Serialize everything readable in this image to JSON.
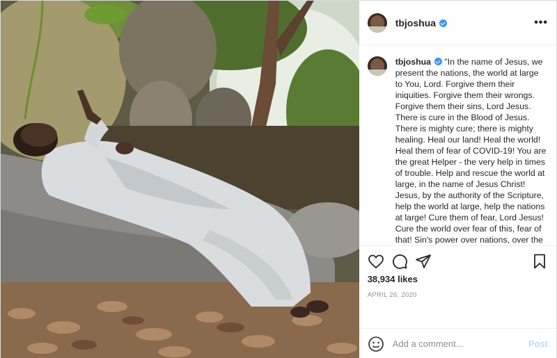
{
  "post": {
    "username": "tbjoshua",
    "caption_username": "tbjoshua",
    "caption_text": "\"In the name of Jesus, we present the nations, the world at large to You, Lord. Forgive them their iniquities. Forgive them their wrongs. Forgive them their sins, Lord Jesus. There is cure in the Blood of Jesus. There is mighty cure; there is mighty healing. Heal our land! Heal the world! Heal them of fear of COVID-19! You are the great Helper - the very help in times of trouble. Help and rescue the world at large, in the name of Jesus Christ! Jesus, by the authority of the Scripture, help the world at large, help the nations at large! Cure them of fear, Lord Jesus! Cure the world over fear of this, fear of that! Sin's power over nations, over the world - be broken, in the name of Jesus Christ! Thank You, Lord! In Jesus Christ's name, Amen.\"",
    "more_label": "•••",
    "likes": "38,934 likes",
    "date": "APRIL 26, 2020"
  },
  "comment": {
    "placeholder": "Add a comment...",
    "post_label": "Post"
  },
  "icons": {
    "verified": "verified-badge-icon",
    "like": "heart-icon",
    "comment": "comment-icon",
    "share": "send-icon",
    "save": "bookmark-icon",
    "emoji": "smiley-icon"
  },
  "colors": {
    "verified": "#3897f0",
    "post_button": "#b2dffc",
    "muted_text": "#8e8e8e"
  }
}
